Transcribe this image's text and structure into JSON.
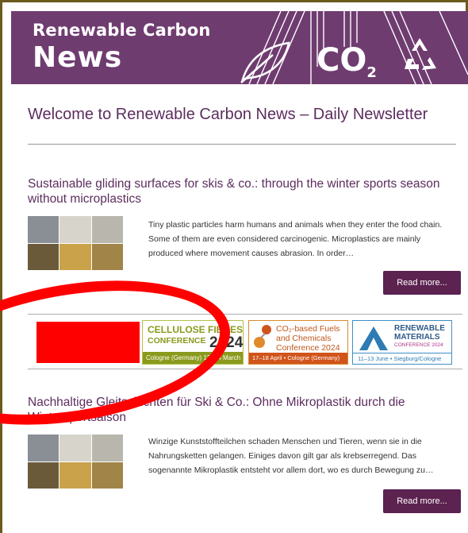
{
  "header": {
    "brand_line1": "Renewable Carbon",
    "brand_line2": "News",
    "co2_icon_text": "CO",
    "co2_sub": "2",
    "brand_color": "#6f3c70"
  },
  "welcome_title": "Welcome to Renewable Carbon News – Daily Newsletter",
  "articles": [
    {
      "title": "Sustainable gliding surfaces for skis & co.: through the winter sports season without microplastics",
      "excerpt": "Tiny plastic particles harm humans and animals when they enter the food chain. Some of them are even considered carcinogenic. Microplastics are mainly produced where movement causes abrasion. In order…",
      "read_more": "Read more..."
    },
    {
      "title": "Nachhaltige Gleitschichten für Ski & Co.: Ohne Mikroplastik durch die Wintersportsaison",
      "excerpt": "Winzige Kunststoffteilchen schaden Menschen und Tieren, wenn sie in die Nahrungsketten gelangen. Einiges davon gilt gar als krebserregend. Das sogenannte Mikroplastik entsteht vor allem dort, wo es durch Bewegung zu…",
      "read_more": "Read more..."
    }
  ],
  "sponsors": {
    "cellulose": {
      "line1": "CELLULOSE FIBRES",
      "line2": "CONFERENCE",
      "year": "2024",
      "footer": "Cologne (Germany) 13–14 March"
    },
    "co2fuels": {
      "line1": "CO₂-based Fuels",
      "line2": "and Chemicals",
      "line3": "Conference 2024",
      "footer": "17–18 April • Cologne (Germany)"
    },
    "materials": {
      "line1": "RENEWABLE",
      "line2": "MATERIALS",
      "line3": "CONFERENCE 2024",
      "footer": "11–13 June • Siegburg/Cologne"
    }
  },
  "colors": {
    "title": "#5c2d5e",
    "button": "#5c2250",
    "annotation_red": "#ff0000"
  }
}
